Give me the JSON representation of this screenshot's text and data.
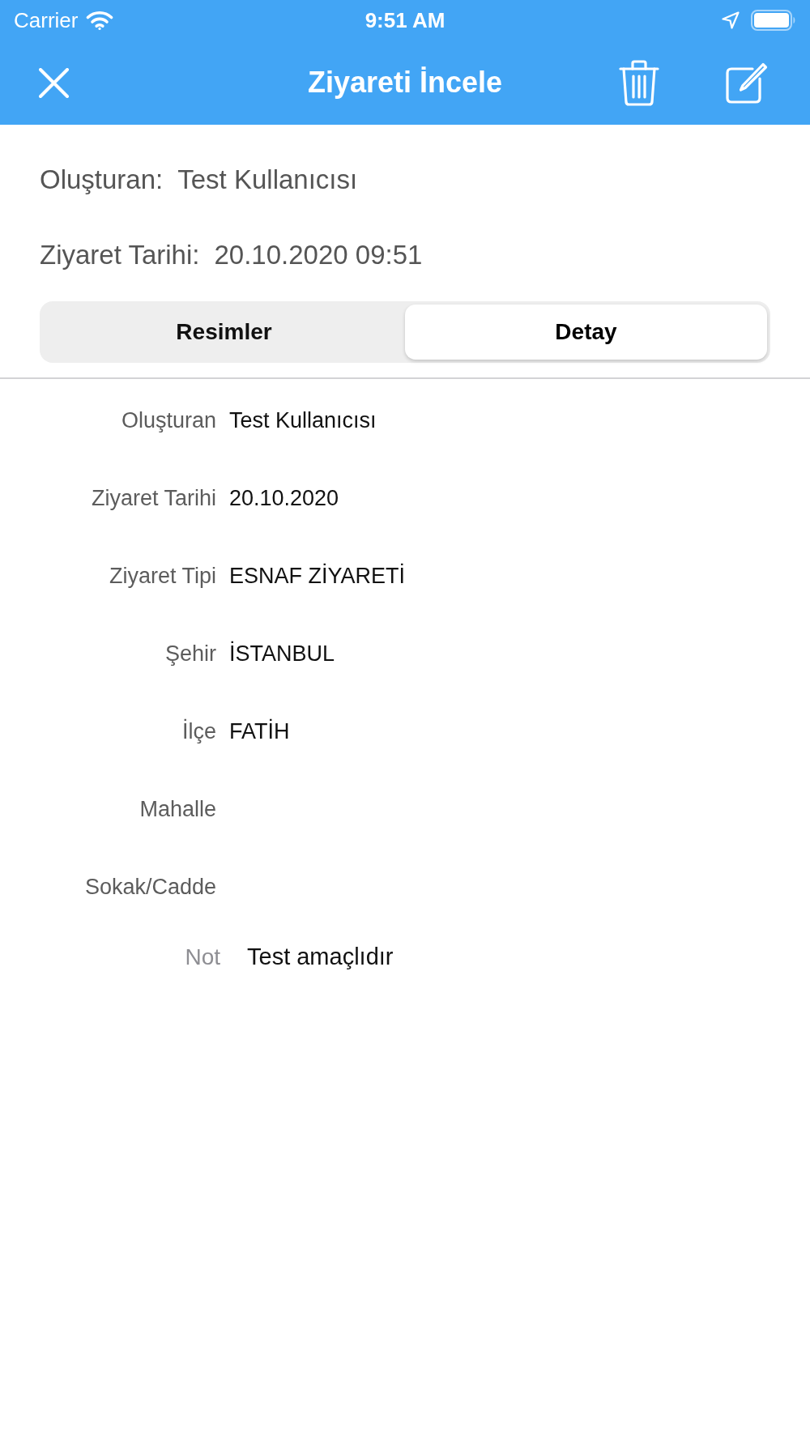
{
  "status_bar": {
    "carrier": "Carrier",
    "time": "9:51 AM"
  },
  "nav_bar": {
    "title": "Ziyareti İncele"
  },
  "summary": [
    {
      "label": "Oluşturan:",
      "value": "Test Kullanıcısı"
    },
    {
      "label": "Ziyaret Tarihi:",
      "value": "20.10.2020 09:51"
    }
  ],
  "tabs": [
    {
      "label": "Resimler",
      "selected": false
    },
    {
      "label": "Detay",
      "selected": true
    }
  ],
  "details": [
    {
      "label": "Oluşturan",
      "value": "Test Kullanıcısı"
    },
    {
      "label": "Ziyaret Tarihi",
      "value": "20.10.2020"
    },
    {
      "label": "Ziyaret Tipi",
      "value": "ESNAF ZİYARETİ"
    },
    {
      "label": "Şehir",
      "value": "İSTANBUL"
    },
    {
      "label": "İlçe",
      "value": "FATİH"
    },
    {
      "label": "Mahalle"
    },
    {
      "label": "Sokak/Cadde"
    }
  ],
  "note": {
    "label": "Not",
    "value": "Test amaçlıdır"
  }
}
